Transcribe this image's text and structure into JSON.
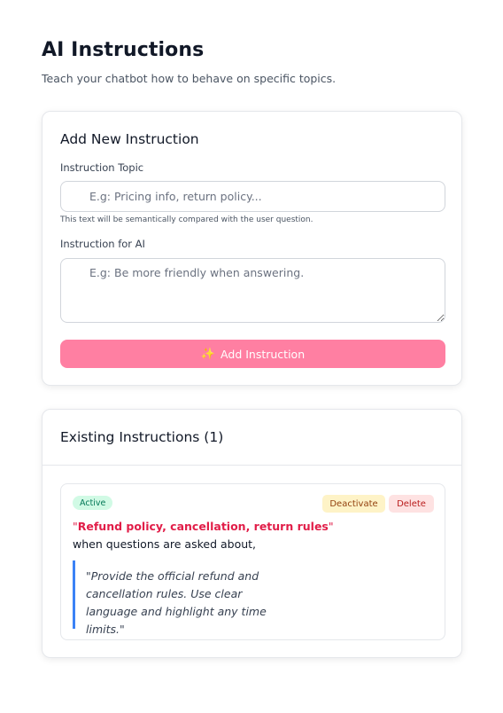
{
  "header": {
    "title": "AI Instructions",
    "subtitle": "Teach your chatbot how to behave on specific topics."
  },
  "add_form": {
    "title": "Add New Instruction",
    "topic_label": "Instruction Topic",
    "topic_placeholder": "E.g: Pricing info, return policy...",
    "topic_value": "",
    "topic_help": "This text will be semantically compared with the user question.",
    "ai_label": "Instruction for AI",
    "ai_placeholder": "E.g: Be more friendly when answering.",
    "ai_value": "",
    "submit_label": "Add Instruction",
    "submit_icon": "sparkles-icon",
    "accent_color": "#ff7fa2"
  },
  "existing": {
    "title": "Existing Instructions (1)",
    "items": [
      {
        "status": "Active",
        "deactivate_label": "Deactivate",
        "delete_label": "Delete",
        "topic": "Refund policy, cancellation, return rules",
        "when_text": "when questions are asked about,",
        "instruction": "\"Provide the official refund and cancellation rules. Use clear language and highlight any time limits.\""
      }
    ]
  }
}
